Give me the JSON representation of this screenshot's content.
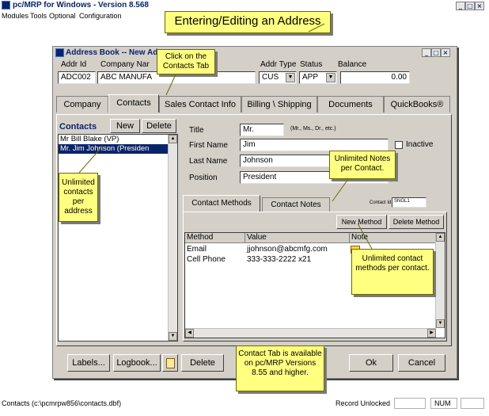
{
  "app": {
    "title": "pc/MRP for Windows - Version 8.568",
    "menu": [
      "Modules",
      "Tools",
      "Optional",
      "Configuration"
    ]
  },
  "callouts": {
    "main_title": "Entering/Editing an Address",
    "contacts_tab": "Click on the Contacts Tab",
    "unlimited_contacts": "Unlimited contacts per address",
    "unlimited_notes": "Unlimited Notes per Contact.",
    "unlimited_methods": "Unlimited contact methods per contact.",
    "version": "Contact Tab is available on pc/MRP Versions 8.55 and higher."
  },
  "dialog": {
    "title": "Address Book -- New Ad",
    "headers": {
      "addr_id": "Addr Id",
      "company_name": "Company Nar",
      "addr_type": "Addr Type",
      "status": "Status",
      "balance": "Balance"
    },
    "values": {
      "addr_id": "ADC002",
      "company_name": "ABC MANUFA",
      "addr_type": "CUS",
      "status": "APP",
      "balance": "0.00"
    },
    "tabs": [
      "Company",
      "Contacts",
      "Sales Contact Info",
      "Billing \\ Shipping",
      "Documents",
      "QuickBooks®"
    ],
    "active_tab": "Contacts"
  },
  "contacts": {
    "header": "Contacts",
    "new_label": "New",
    "delete_label": "Delete",
    "list": [
      "Mr Bill Blake   (VP)",
      "Mr. Jim Johnson   (Presiden"
    ]
  },
  "contact_form": {
    "title_label": "Title",
    "title_value": "Mr.",
    "title_hint": "(Mr., Ms., Dr., etc.)",
    "first_name_label": "First Name",
    "first_name_value": "Jim",
    "last_name_label": "Last Name",
    "last_name_value": "Johnson",
    "position_label": "Position",
    "position_value": "President",
    "inactive_label": "Inactive"
  },
  "subtabs": {
    "methods": "Contact Methods",
    "notes": "Contact Notes",
    "contact_id_label": "Contact Id",
    "contact_id_value": "SNGL1"
  },
  "methods": {
    "new_method": "New Method",
    "delete_method": "Delete Method",
    "columns": [
      "Method",
      "Value",
      "Note"
    ],
    "rows": [
      {
        "method": "Email",
        "value": "jjohnson@abcmfg.com"
      },
      {
        "method": "Cell Phone",
        "value": "333-333-2222 x21"
      }
    ]
  },
  "bottom_buttons": {
    "labels": "Labels...",
    "logbook": "Logbook...",
    "delete": "Delete",
    "ok": "Ok",
    "cancel": "Cancel"
  },
  "status_bar": {
    "path": "Contacts (c:\\pcmrpw856\\contacts.dbf)",
    "lock": "Record Unlocked",
    "num": "NUM"
  },
  "colors": {
    "callout": "#ffff80",
    "titlebar_text": "#0a246a",
    "selection": "#0a246a",
    "dialog_face": "#d4d0c8"
  }
}
